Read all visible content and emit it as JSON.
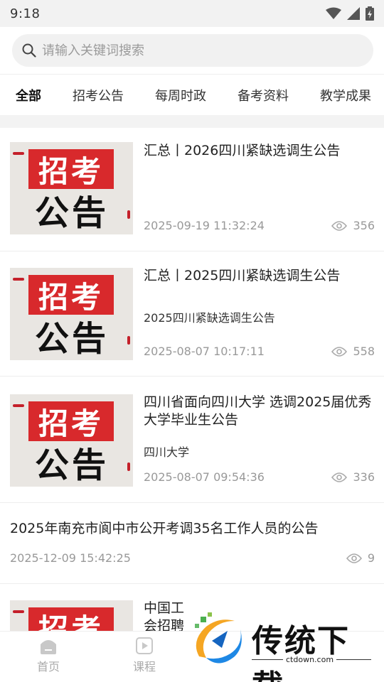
{
  "status": {
    "time": "9:18"
  },
  "search": {
    "placeholder": "请输入关键词搜索"
  },
  "tabs": [
    "全部",
    "招考公告",
    "每周时政",
    "备考资料",
    "教学成果"
  ],
  "thumb": {
    "line1": "招考",
    "line2": "公告"
  },
  "articles": [
    {
      "title": "汇总丨2026四川紧缺选调生公告",
      "subtitle": "",
      "date": "2025-09-19 11:32:24",
      "views": "356"
    },
    {
      "title": "汇总丨2025四川紧缺选调生公告",
      "subtitle": "2025四川紧缺选调生公告",
      "date": "2025-08-07 10:17:11",
      "views": "558"
    },
    {
      "title": "四川省面向四川大学 选调2025届优秀大学毕业生公告",
      "subtitle": "四川大学",
      "date": "2025-08-07 09:54:36",
      "views": "336"
    },
    {
      "title": "2025年南充市阆中市公开考调35名工作人员的公告",
      "subtitle": "",
      "date": "2025-12-09 15:42:25",
      "views": "9"
    },
    {
      "title": "中国工 会招聘",
      "subtitle": "",
      "date": "",
      "views": ""
    }
  ],
  "nav": {
    "home": "首页",
    "course": "课程"
  },
  "watermark": {
    "name": "传统下载",
    "url": "ctdown.com"
  }
}
